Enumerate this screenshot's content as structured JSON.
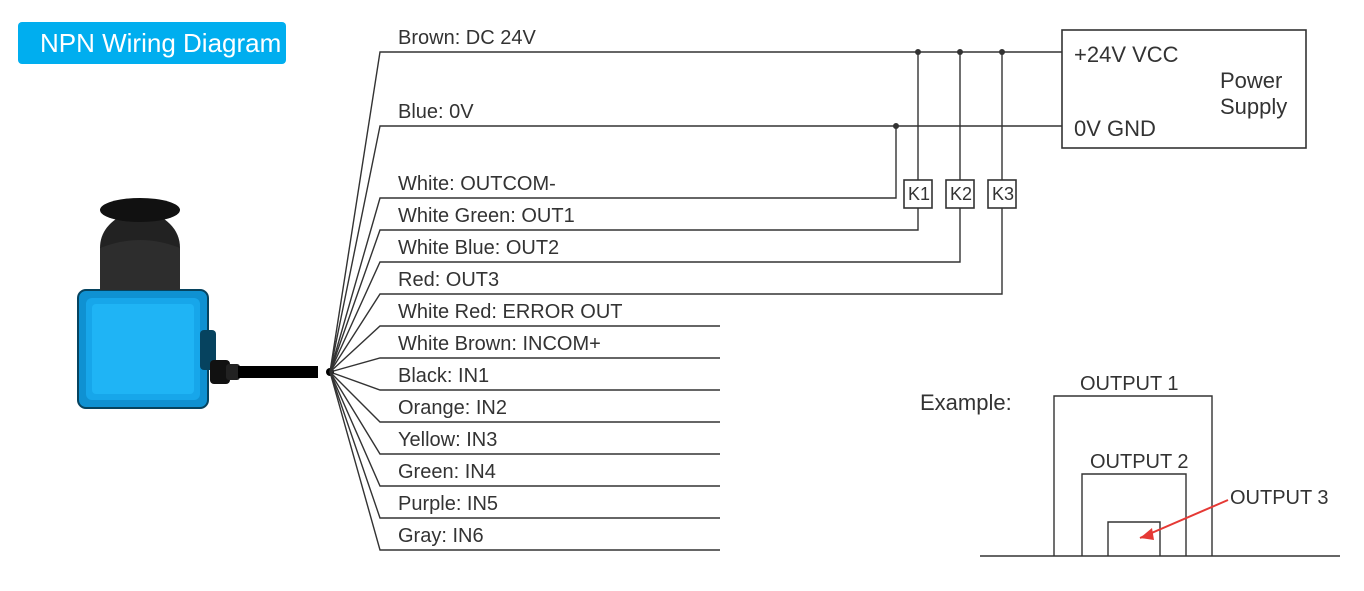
{
  "title": "NPN Wiring Diagram",
  "power_supply": {
    "vcc": "+24V VCC",
    "gnd": "0V GND",
    "label1": "Power",
    "label2": "Supply"
  },
  "relays": {
    "k1": "K1",
    "k2": "K2",
    "k3": "K3"
  },
  "wires": [
    {
      "label": "Brown: DC 24V"
    },
    {
      "label": "Blue: 0V"
    },
    {
      "label": "White: OUTCOM-"
    },
    {
      "label": "White Green: OUT1"
    },
    {
      "label": "White Blue: OUT2"
    },
    {
      "label": "Red: OUT3"
    },
    {
      "label": "White Red: ERROR OUT"
    },
    {
      "label": "White Brown: INCOM+"
    },
    {
      "label": "Black: IN1"
    },
    {
      "label": "Orange: IN2"
    },
    {
      "label": "Yellow: IN3"
    },
    {
      "label": "Green: IN4"
    },
    {
      "label": "Purple: IN5"
    },
    {
      "label": "Gray: IN6"
    }
  ],
  "example": {
    "heading": "Example:",
    "out1": "OUTPUT 1",
    "out2": "OUTPUT 2",
    "out3": "OUTPUT 3"
  }
}
